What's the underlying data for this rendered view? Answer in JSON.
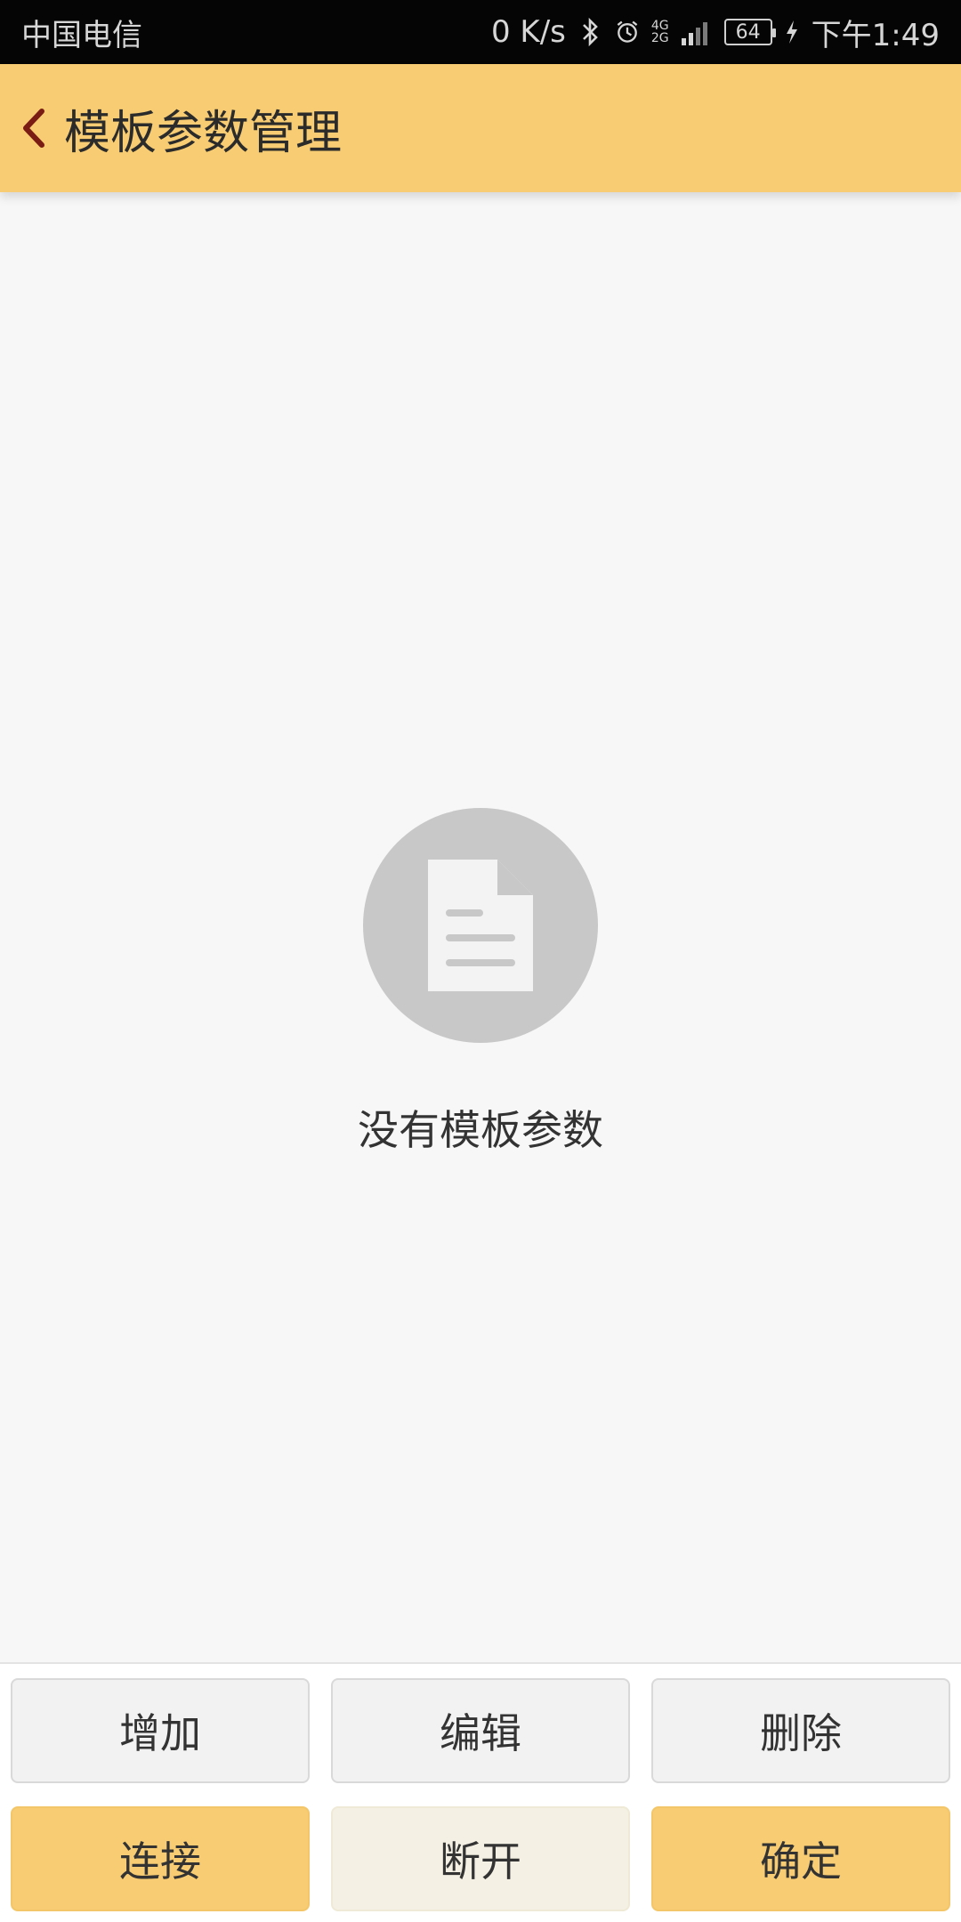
{
  "status_bar": {
    "carrier": "中国电信",
    "net_speed": "0 K/s",
    "network_top": "4G",
    "network_bottom": "2G",
    "battery": "64",
    "time": "下午1:49"
  },
  "header": {
    "title": "模板参数管理"
  },
  "empty_state": {
    "message": "没有模板参数"
  },
  "buttons": {
    "add": "增加",
    "edit": "编辑",
    "delete": "删除",
    "connect": "连接",
    "disconnect": "断开",
    "confirm": "确定"
  },
  "colors": {
    "accent": "#f7cc72",
    "back_arrow": "#7a1b14",
    "empty_icon_bg": "#c8c8c8"
  }
}
